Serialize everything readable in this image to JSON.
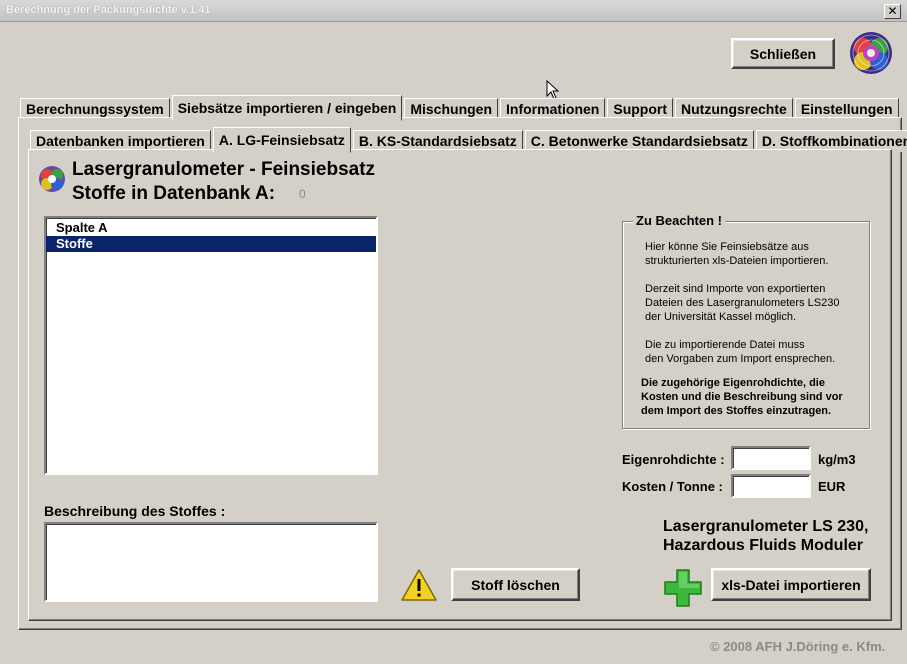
{
  "window": {
    "title": "Berechnung der Packungsdichte v.1.41",
    "close_glyph": "✕"
  },
  "header": {
    "close_button_label": "Schließen"
  },
  "main_tabs": [
    {
      "label": "Berechnungssystem",
      "active": false
    },
    {
      "label": "Siebsätze importieren / eingeben",
      "active": true
    },
    {
      "label": "Mischungen",
      "active": false
    },
    {
      "label": "Informationen",
      "active": false
    },
    {
      "label": "Support",
      "active": false
    },
    {
      "label": "Nutzungsrechte",
      "active": false
    },
    {
      "label": "Einstellungen",
      "active": false
    }
  ],
  "sub_tabs": [
    {
      "label": "Datenbanken importieren",
      "active": false
    },
    {
      "label": "A. LG-Feinsiebsatz",
      "active": true
    },
    {
      "label": "B. KS-Standardsiebsatz",
      "active": false
    },
    {
      "label": "C. Betonwerke Standardsiebsatz",
      "active": false
    },
    {
      "label": "D. Stoffkombinationen",
      "active": false
    }
  ],
  "content": {
    "title": "Lasergranulometer - Feinsiebsatz",
    "subtitle": "Stoffe in Datenbank A:",
    "count": "0",
    "list": [
      {
        "label": "Spalte A",
        "selected": false
      },
      {
        "label": "Stoffe",
        "selected": true
      }
    ],
    "description_label": "Beschreibung des Stoffes :",
    "delete_button": "Stoff löschen",
    "warning_icon": "warning-triangle-icon"
  },
  "notice": {
    "title": "Zu Beachten !",
    "lines": [
      "Hier könne Sie Feinsiebsätze aus",
      "strukturierten xls-Dateien importieren.",
      "Derzeit sind Importe von exportierten",
      "Dateien des Lasergranulometers LS230",
      "der Universität Kassel möglich.",
      "Die zu importierende Datei muss",
      "den Vorgaben zum Import ensprechen."
    ],
    "bold_lines": [
      "Die zugehörige Eigenrohdichte, die",
      "Kosten und die Beschreibung sind vor",
      "dem Import des Stoffes einzutragen."
    ]
  },
  "fields": {
    "density_label": "Eigenrohdichte :",
    "density_value": "",
    "density_unit": "kg/m3",
    "cost_label": "Kosten / Tonne :",
    "cost_value": "",
    "cost_unit": "EUR"
  },
  "device": {
    "line1": "Lasergranulometer LS 230,",
    "line2": "Hazardous Fluids Moduler"
  },
  "import_button": "xls-Datei importieren",
  "footer": "© 2008  AFH J.Döring e. Kfm."
}
